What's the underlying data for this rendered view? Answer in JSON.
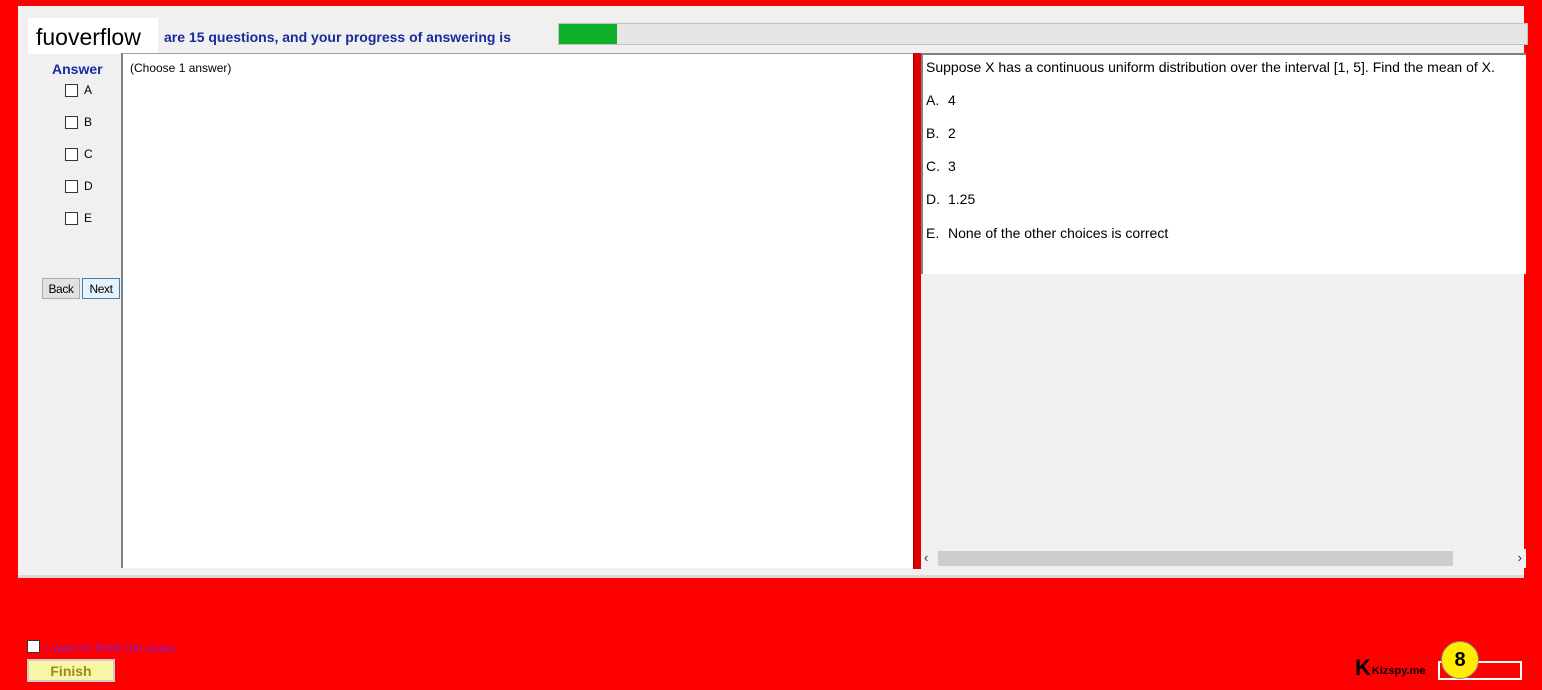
{
  "header": {
    "logo_text": "fuoverflow",
    "progress_text": "are 15 questions, and your progress of answering is",
    "progress_fraction": 0.06
  },
  "answer_panel": {
    "title": "Answer",
    "options": [
      {
        "label": "A",
        "checked": false
      },
      {
        "label": "B",
        "checked": false
      },
      {
        "label": "C",
        "checked": false
      },
      {
        "label": "D",
        "checked": false
      },
      {
        "label": "E",
        "checked": false
      }
    ],
    "back_label": "Back",
    "next_label": "Next"
  },
  "answer_box": {
    "instruction": "(Choose 1 answer)"
  },
  "question": {
    "text": "Suppose X has a continuous uniform distribution over the interval [1, 5]. Find the mean of X.",
    "choices": [
      {
        "letter": "A.",
        "text": "4"
      },
      {
        "letter": "B.",
        "text": "2"
      },
      {
        "letter": "C.",
        "text": "3"
      },
      {
        "letter": "D.",
        "text": "1.25"
      },
      {
        "letter": "E.",
        "text": "None of the other choices is correct"
      }
    ]
  },
  "footer": {
    "finish_checkbox_label": "I want to finish the exam",
    "finish_button_label": "Finish",
    "brand_text": "Kizspy.me",
    "badge_number": "8"
  },
  "colors": {
    "background": "#ff0000",
    "progress_fill": "#10b02a",
    "heading_blue": "#1a2a9c"
  },
  "icons": {
    "scroll_left": "‹",
    "scroll_right": "›",
    "brand_mark": "K"
  }
}
